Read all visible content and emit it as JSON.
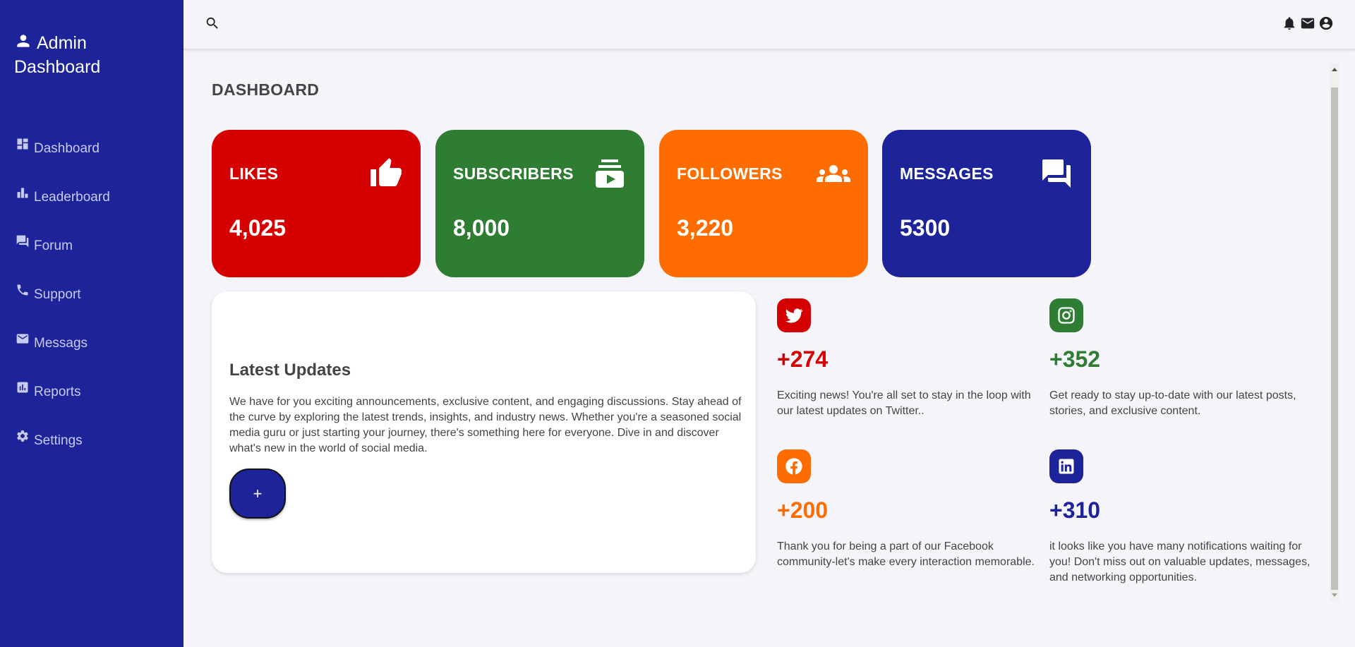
{
  "sidebar": {
    "brand": "Admin Dashboard",
    "items": [
      {
        "label": "Dashboard"
      },
      {
        "label": "Leaderboard"
      },
      {
        "label": "Forum"
      },
      {
        "label": "Support"
      },
      {
        "label": "Messags"
      },
      {
        "label": "Reports"
      },
      {
        "label": "Settings"
      }
    ]
  },
  "header": {
    "title": "DASHBOARD"
  },
  "cards": [
    {
      "label": "LIKES",
      "value": "4,025",
      "color": "#d50000",
      "icon": "thumb-up-icon"
    },
    {
      "label": "SUBSCRIBERS",
      "value": "8,000",
      "color": "#2e7d32",
      "icon": "subscriptions-icon"
    },
    {
      "label": "FOLLOWERS",
      "value": "3,220",
      "color": "#ff6d00",
      "icon": "groups-icon"
    },
    {
      "label": "MESSAGES",
      "value": "5300",
      "color": "#1d2399",
      "icon": "forum-icon"
    }
  ],
  "updates": {
    "title": "Latest Updates",
    "text": "We have for you exciting announcements, exclusive content, and engaging discussions. Stay ahead of the curve by exploring the latest trends, insights, and industry news. Whether you're a seasoned social media guru or just starting your journey, there's something here for everyone. Dive in and discover what's new in the world of social media.",
    "button_label": "+"
  },
  "social": [
    {
      "network": "twitter",
      "count": "+274",
      "color": "#d50000",
      "icon": "twitter-icon",
      "text": "Exciting news! You're all set to stay in the loop with our latest updates on Twitter.."
    },
    {
      "network": "instagram",
      "count": "+352",
      "color": "#2e7d32",
      "icon": "instagram-icon",
      "text": "Get ready to stay up-to-date with our latest posts, stories, and exclusive content."
    },
    {
      "network": "facebook",
      "count": "+200",
      "color": "#ff6d00",
      "icon": "facebook-icon",
      "text": "Thank you for being a part of our Facebook community-let's make every interaction memorable."
    },
    {
      "network": "linkedin",
      "count": "+310",
      "color": "#1d2399",
      "icon": "linkedin-icon",
      "text": "it looks like you have many notifications waiting for you! Don't miss out on valuable updates, messages, and networking opportunities."
    }
  ],
  "colors": {
    "sidebar_bg": "#1d2399",
    "page_bg": "#f4f4fa",
    "text": "#444444"
  }
}
